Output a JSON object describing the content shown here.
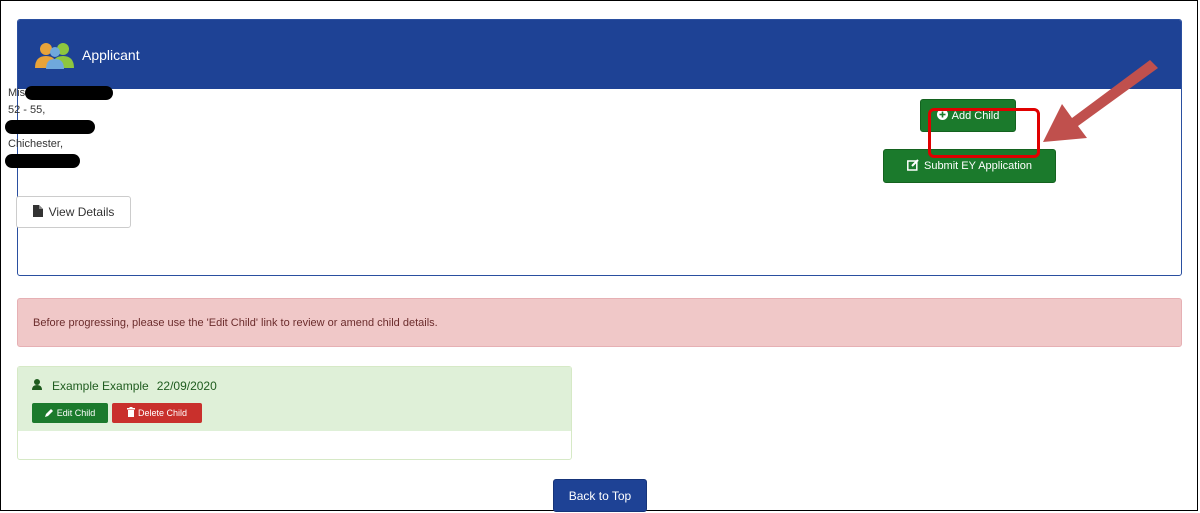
{
  "applicant_panel": {
    "title": "Applicant",
    "address": {
      "line1": "Miss",
      "line2": "52 - 55,",
      "line4": "Chichester,"
    },
    "view_details_label": "View Details",
    "add_child_label": "Add Child",
    "submit_label": "Submit EY Application"
  },
  "alert": {
    "text": "Before progressing, please use the 'Edit Child' link to review or amend child details."
  },
  "child": {
    "name": "Example Example",
    "dob": "22/09/2020",
    "edit_label": "Edit Child",
    "delete_label": "Delete Child"
  },
  "footer": {
    "back_to_top_label": "Back to Top"
  },
  "colors": {
    "header_blue": "#1e4295",
    "button_green": "#1b7a2c",
    "delete_red": "#c9302c",
    "alert_bg": "#f0c8c8",
    "child_bg": "#dff0d8",
    "annotation_red": "#c0504d"
  }
}
